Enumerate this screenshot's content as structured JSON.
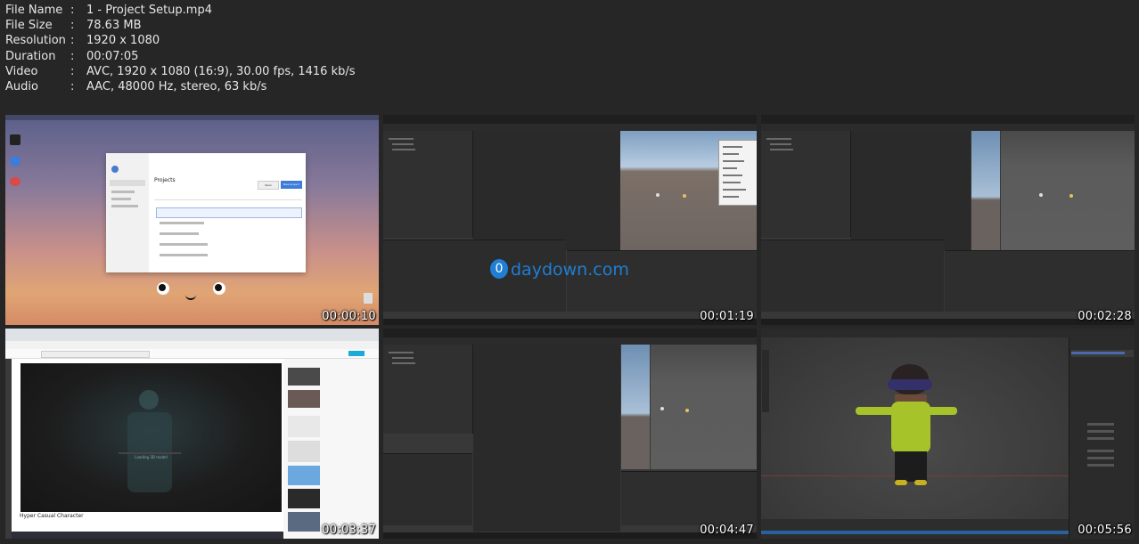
{
  "file_info": [
    {
      "label": "File Name",
      "value": "1 - Project Setup.mp4"
    },
    {
      "label": "File Size",
      "value": "78.63 MB"
    },
    {
      "label": "Resolution",
      "value": "1920 x 1080"
    },
    {
      "label": "Duration",
      "value": "00:07:05"
    },
    {
      "label": "Video",
      "value": "AVC, 1920 x 1080 (16:9), 30.00 fps, 1416 kb/s"
    },
    {
      "label": "Audio",
      "value": "AAC, 48000 Hz, stereo, 63 kb/s"
    }
  ],
  "separator": ":",
  "thumbnails": [
    {
      "time": "00:00:10",
      "scene": "unity-hub",
      "hub_title": "Projects",
      "hub_button_new": "New project",
      "hub_button_open": "Open"
    },
    {
      "time": "00:01:19",
      "scene": "unity-editor"
    },
    {
      "time": "00:02:28",
      "scene": "unity-editor"
    },
    {
      "time": "00:03:37",
      "scene": "sketchfab",
      "viewer_caption": "Hyper Casual Character",
      "loading_text": "Loading 3D model"
    },
    {
      "time": "00:04:47",
      "scene": "unity-editor"
    },
    {
      "time": "00:05:56",
      "scene": "blender"
    }
  ],
  "watermark": "daydown.com",
  "watermark_badge": "0"
}
